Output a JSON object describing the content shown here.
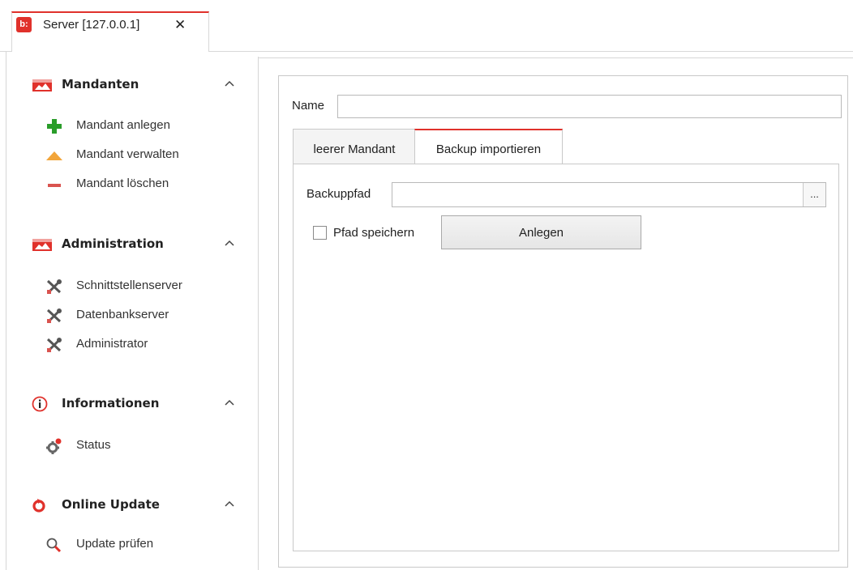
{
  "tab": {
    "title": "Server [127.0.0.1]",
    "logo_text": "b:",
    "close_glyph": "✕"
  },
  "sidebar": {
    "groups": [
      {
        "title": "Mandanten",
        "icon": "mandanten-flag-icon",
        "collapse_glyph": "^",
        "items": [
          {
            "label": "Mandant anlegen",
            "icon": "plus-icon"
          },
          {
            "label": "Mandant verwalten",
            "icon": "triangle-up-icon"
          },
          {
            "label": "Mandant löschen",
            "icon": "minus-icon"
          }
        ]
      },
      {
        "title": "Administration",
        "icon": "administration-flag-icon",
        "collapse_glyph": "^",
        "items": [
          {
            "label": "Schnittstellenserver",
            "icon": "tools-icon"
          },
          {
            "label": "Datenbankserver",
            "icon": "tools-icon"
          },
          {
            "label": "Administrator",
            "icon": "tools-icon"
          }
        ]
      },
      {
        "title": "Informationen",
        "icon": "info-icon",
        "collapse_glyph": "^",
        "items": [
          {
            "label": "Status",
            "icon": "gear-status-icon"
          }
        ]
      },
      {
        "title": "Online Update",
        "icon": "refresh-icon",
        "collapse_glyph": "^",
        "items": [
          {
            "label": "Update prüfen",
            "icon": "search-icon"
          }
        ]
      }
    ]
  },
  "form": {
    "name_label": "Name",
    "name_value": "",
    "tabs": [
      {
        "label": "leerer Mandant",
        "active": false
      },
      {
        "label": "Backup importieren",
        "active": true
      }
    ],
    "backup_label": "Backuppfad",
    "backup_value": "",
    "browse_label": "...",
    "save_path_label": "Pfad speichern",
    "save_path_checked": false,
    "create_label": "Anlegen"
  },
  "colors": {
    "accent": "#e0312b",
    "plus": "#2a9d2a",
    "triangle": "#f2a53a",
    "minus": "#d9534f"
  }
}
